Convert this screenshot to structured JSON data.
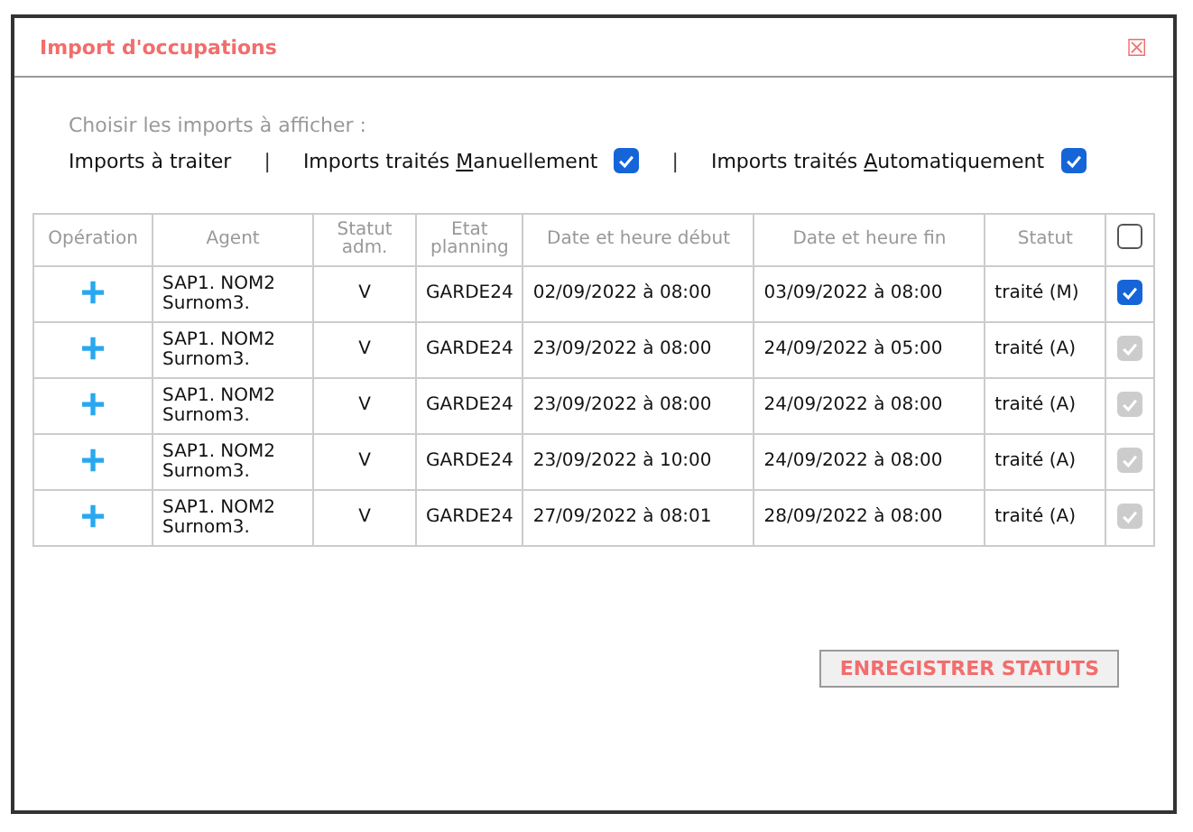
{
  "window": {
    "title": "Import d'occupations",
    "close": "☒"
  },
  "filter": {
    "caption": "Choisir les imports à afficher :",
    "separator": "|",
    "options": [
      {
        "kind": "text",
        "label": "Imports à traiter"
      },
      {
        "kind": "checkbox",
        "label_before": "Imports traités ",
        "accesskey": "M",
        "label_after": "anuellement",
        "checked": true
      },
      {
        "kind": "checkbox",
        "label_before": "Imports traités ",
        "accesskey": "A",
        "label_after": "utomatiquement",
        "checked": true
      }
    ]
  },
  "table": {
    "columns": [
      "Opération",
      "Agent",
      "Statut adm.",
      "Etat planning",
      "Date et heure début",
      "Date et heure fin",
      "Statut"
    ],
    "select_all": {
      "checked": false
    },
    "rows": [
      {
        "operation": "+",
        "agent": "SAP1. NOM2 Surnom3.",
        "statut_adm": "V",
        "etat": "GARDE24",
        "debut": "02/09/2022 à 08:00",
        "fin": "03/09/2022 à 08:00",
        "statut": "traité (M)",
        "checked": true,
        "disabled": false
      },
      {
        "operation": "+",
        "agent": "SAP1. NOM2 Surnom3.",
        "statut_adm": "V",
        "etat": "GARDE24",
        "debut": "23/09/2022 à 08:00",
        "fin": "24/09/2022 à 05:00",
        "statut": "traité (A)",
        "checked": true,
        "disabled": true
      },
      {
        "operation": "+",
        "agent": "SAP1. NOM2 Surnom3.",
        "statut_adm": "V",
        "etat": "GARDE24",
        "debut": "23/09/2022 à 08:00",
        "fin": "24/09/2022 à 08:00",
        "statut": "traité (A)",
        "checked": true,
        "disabled": true
      },
      {
        "operation": "+",
        "agent": "SAP1. NOM2 Surnom3.",
        "statut_adm": "V",
        "etat": "GARDE24",
        "debut": "23/09/2022 à 10:00",
        "fin": "24/09/2022 à 08:00",
        "statut": "traité (A)",
        "checked": true,
        "disabled": true
      },
      {
        "operation": "+",
        "agent": "SAP1. NOM2 Surnom3.",
        "statut_adm": "V",
        "etat": "GARDE24",
        "debut": "27/09/2022 à 08:01",
        "fin": "28/09/2022 à 08:00",
        "statut": "traité (A)",
        "checked": true,
        "disabled": true
      }
    ]
  },
  "save_button": "ENREGISTRER STATUTS"
}
